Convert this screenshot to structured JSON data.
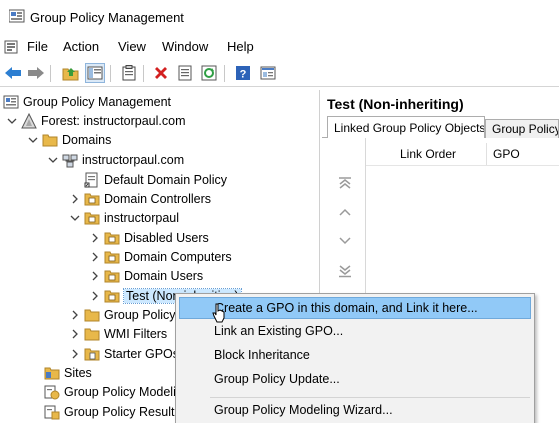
{
  "window": {
    "title": "Group Policy Management"
  },
  "menu": [
    "File",
    "Action",
    "View",
    "Window",
    "Help"
  ],
  "toolbar": {
    "buttons": [
      "back-icon",
      "forward-icon",
      "up-folder-icon",
      "show-hide-tree-icon",
      "clipboard-icon",
      "delete-icon",
      "properties-icon",
      "refresh-icon",
      "help-icon",
      "console-icon"
    ]
  },
  "tree": {
    "root": "Group Policy Management",
    "forest": "Forest: instructorpaul.com",
    "domains": "Domains",
    "domain": "instructorpaul.com",
    "default_policy": "Default Domain Policy",
    "domain_controllers": "Domain Controllers",
    "ou": "instructorpaul",
    "disabled_users": "Disabled Users",
    "domain_computers": "Domain Computers",
    "domain_users": "Domain Users",
    "test": "Test (Non-inheriting)",
    "gpo_objects": "Group Policy Objects",
    "wmi_filters": "WMI Filters",
    "starter_gpos": "Starter GPOs",
    "sites": "Sites",
    "modeling": "Group Policy Modeling",
    "results": "Group Policy Results"
  },
  "right_pane": {
    "heading": "Test (Non-inheriting)",
    "tabs": [
      "Linked Group Policy Objects",
      "Group Policy Inheritance"
    ],
    "columns": [
      "Link Order",
      "GPO"
    ]
  },
  "context_menu": {
    "items": [
      "Create a GPO in this domain, and Link it here...",
      "Link an Existing GPO...",
      "Block Inheritance",
      "Group Policy Update...",
      "Group Policy Modeling Wizard..."
    ]
  },
  "colors": {
    "selection": "#cce8ff",
    "menu_hover": "#91c9f7",
    "folder": "#e8b84a"
  }
}
